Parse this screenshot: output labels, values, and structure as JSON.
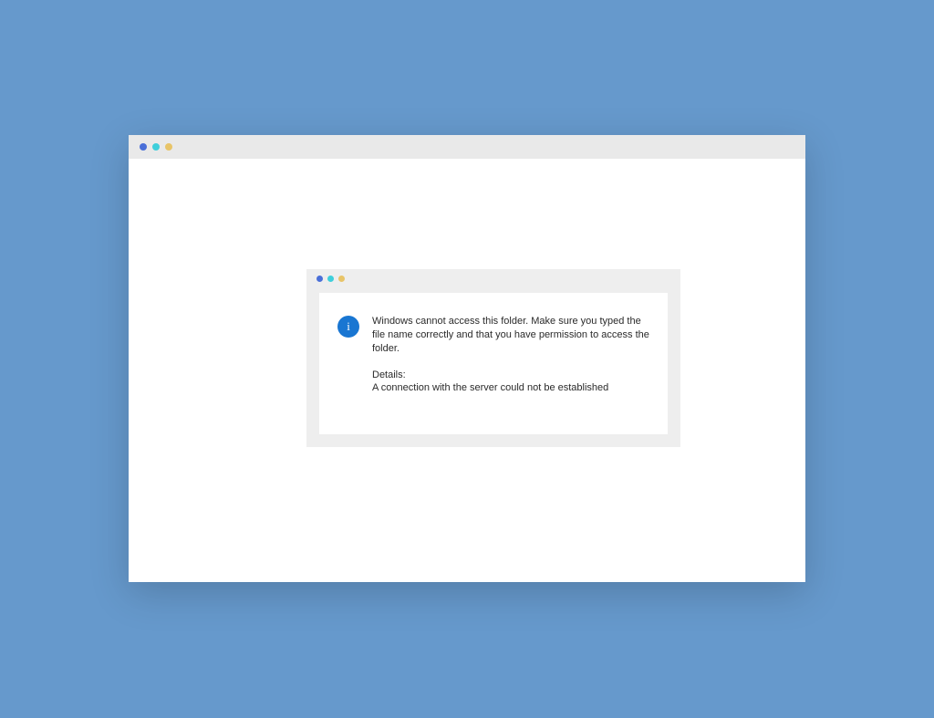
{
  "dialog": {
    "icon_glyph": "i",
    "message": "Windows cannot access this folder. Make sure you typed the file name correctly and that you have permission to access the folder.",
    "details_label": "Details:",
    "details_text": "A connection with the server could not be established"
  }
}
